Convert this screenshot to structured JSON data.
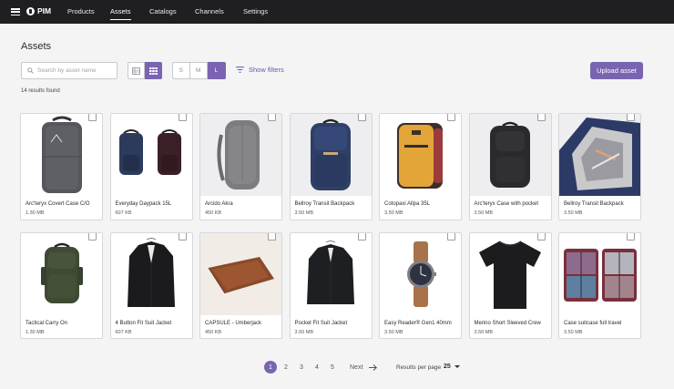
{
  "app": {
    "name": "PIM"
  },
  "nav": [
    {
      "label": "Products"
    },
    {
      "label": "Assets"
    },
    {
      "label": "Catalogs"
    },
    {
      "label": "Channels"
    },
    {
      "label": "Settings"
    }
  ],
  "page": {
    "title": "Assets",
    "results": "14 results found"
  },
  "search": {
    "placeholder": "Search by asset name",
    "value": ""
  },
  "view": {
    "active": "grid"
  },
  "size": {
    "options": [
      "S",
      "M",
      "L"
    ],
    "active": "L"
  },
  "filters": {
    "label": "Show filters"
  },
  "upload": {
    "label": "Upload asset"
  },
  "accent": "#7a64b1",
  "assets": [
    {
      "name": "Arc'teryx Covert Case C/O",
      "size": "1.30 MB",
      "icon": "grey-duffel-backpack"
    },
    {
      "name": "Everyday Daypack 15L",
      "size": "607 KB",
      "icon": "two-daypacks"
    },
    {
      "name": "Arcido Akra",
      "size": "450 KB",
      "icon": "grey-backpack"
    },
    {
      "name": "Bellroy Transit Backpack",
      "size": "3.50 MB",
      "icon": "navy-backpack"
    },
    {
      "name": "Cotopaxi Allpa 35L",
      "size": "3.50 MB",
      "icon": "yellow-backpack"
    },
    {
      "name": "Arc'teryx Case with pocket",
      "size": "3.50 MB",
      "icon": "black-backpack"
    },
    {
      "name": "Bellroy Transit Backpack",
      "size": "3.50 MB",
      "icon": "open-backpack"
    },
    {
      "name": "Tactical Carry On",
      "size": "1.30 MB",
      "icon": "green-backpack"
    },
    {
      "name": "4 Button Fit Suit Jacket",
      "size": "607 KB",
      "icon": "suit-jacket"
    },
    {
      "name": "CAPSULE - Umberjack",
      "size": "450 KB",
      "icon": "leather-sleeve"
    },
    {
      "name": "Pocket Fit Suit Jacket",
      "size": "3.50 MB",
      "icon": "suit-jacket"
    },
    {
      "name": "Easy Reader® Gen1 40mm",
      "size": "3.50 MB",
      "icon": "watch"
    },
    {
      "name": "Merino Short Sleeved Crew",
      "size": "3.50 MB",
      "icon": "black-tshirt"
    },
    {
      "name": "Case suitcase full travel",
      "size": "3.50 MB",
      "icon": "open-suitcase"
    }
  ],
  "pagination": {
    "pages": [
      "1",
      "2",
      "3",
      "4",
      "5"
    ],
    "current": "1",
    "next": "Next"
  },
  "results_per_page": {
    "label": "Results per page",
    "value": "25"
  }
}
